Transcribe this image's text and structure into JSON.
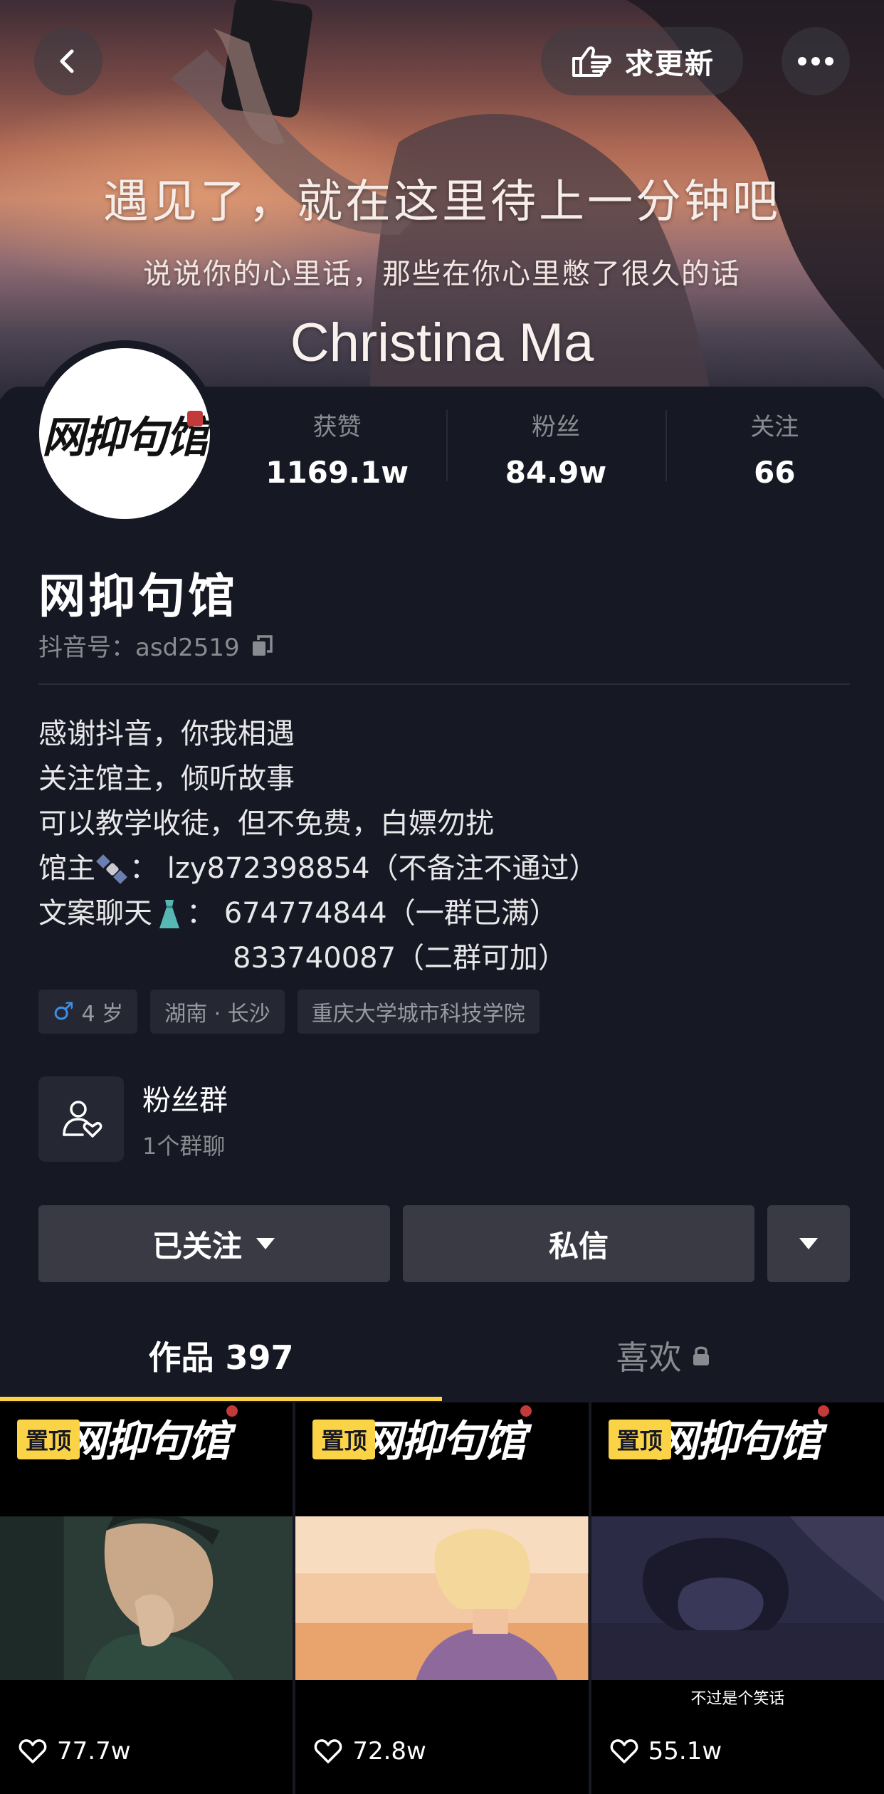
{
  "header": {
    "update_label": "求更新",
    "banner_line1": "遇见了，就在这里待上一分钟吧",
    "banner_line2": "说说你的心里话，那些在你心里憋了很久的话",
    "banner_line3": "Christina Ma"
  },
  "profile": {
    "avatar_text": "网抑句馆",
    "stats": [
      {
        "label": "获赞",
        "value": "1169.1w"
      },
      {
        "label": "粉丝",
        "value": "84.9w"
      },
      {
        "label": "关注",
        "value": "66"
      }
    ],
    "nickname": "网抑句馆",
    "douyin_id": "抖音号：asd2519",
    "bio": {
      "line1": "感谢抖音，你我相遇",
      "line2": "关注馆主，倾听故事",
      "line3": "可以教学收徒，但不免费，白嫖勿扰",
      "line4_prefix": "馆主",
      "line4_rest": "：  lzy872398854（不备注不通过）",
      "line5_prefix": "文案聊天",
      "line5_rest": "：  674774844（一群已满）",
      "line6": "833740087（二群可加）"
    },
    "tags": {
      "gender_symbol": "♂",
      "age": "4 岁",
      "location": "湖南 · 长沙",
      "school": "重庆大学城市科技学院"
    },
    "fan_group": {
      "title": "粉丝群",
      "subtitle": "1个群聊"
    }
  },
  "actions": {
    "follow_label": "已关注",
    "message_label": "私信"
  },
  "tabs": {
    "works_label": "作品 397",
    "likes_label": "喜欢"
  },
  "videos": [
    {
      "pinned_label": "置顶",
      "logo": "网抑句馆",
      "likes": "77.7w",
      "caption": ""
    },
    {
      "pinned_label": "置顶",
      "logo": "网抑句馆",
      "likes": "72.8w",
      "caption": ""
    },
    {
      "pinned_label": "置顶",
      "logo": "网抑句馆",
      "likes": "55.1w",
      "caption": "不过是个笑话"
    }
  ],
  "icons": {
    "back": "chevron-left-icon",
    "update": "pointing-hand-icon",
    "more": "more-dots-icon",
    "copy": "copy-icon",
    "fan_group": "people-heart-icon",
    "dropdown": "caret-down-icon",
    "lock": "lock-icon",
    "like": "heart-icon"
  },
  "colors": {
    "background": "#161823",
    "accent_yellow": "#fbd347",
    "button_gray": "#393a44",
    "male_blue": "#3b8fe8"
  }
}
